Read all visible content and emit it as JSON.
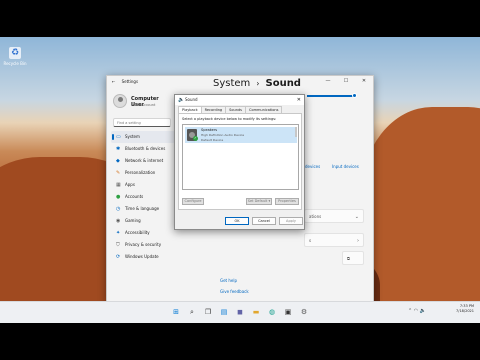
{
  "desktop": {
    "recycle_bin_label": "Recycle Bin"
  },
  "settings": {
    "window_title": "Settings",
    "user": {
      "name": "Computer User",
      "account_type": "Local Account"
    },
    "search_placeholder": "Find a setting",
    "nav": [
      {
        "label": "System",
        "icon": "system-icon",
        "selected": true
      },
      {
        "label": "Bluetooth & devices",
        "icon": "bluetooth-icon"
      },
      {
        "label": "Network & internet",
        "icon": "network-icon"
      },
      {
        "label": "Personalization",
        "icon": "brush-icon"
      },
      {
        "label": "Apps",
        "icon": "apps-icon"
      },
      {
        "label": "Accounts",
        "icon": "account-icon"
      },
      {
        "label": "Time & language",
        "icon": "clock-icon"
      },
      {
        "label": "Gaming",
        "icon": "gamepad-icon"
      },
      {
        "label": "Accessibility",
        "icon": "accessibility-icon"
      },
      {
        "label": "Privacy & security",
        "icon": "shield-icon"
      },
      {
        "label": "Windows Update",
        "icon": "update-icon"
      }
    ],
    "breadcrumb": {
      "parent": "System",
      "current": "Sound"
    },
    "links": {
      "speaker_devices": "devices",
      "input_devices": "Input devices",
      "get_help": "Get help",
      "give_feedback": "Give feedback"
    },
    "cards": [
      "ations",
      "s"
    ]
  },
  "sound_dialog": {
    "title": "Sound",
    "tabs": [
      "Playback",
      "Recording",
      "Sounds",
      "Communications"
    ],
    "instruction": "Select a playback device below to modify its settings:",
    "device": {
      "name": "Speakers",
      "description": "High Definition Audio Device",
      "status": "Default Device"
    },
    "buttons": {
      "configure": "Configure",
      "set_default": "Set Default ▾",
      "properties": "Properties",
      "ok": "OK",
      "cancel": "Cancel",
      "apply": "Apply"
    }
  },
  "taskbar": {
    "time": "7:33 PM",
    "date": "7/18/2021"
  },
  "colors": {
    "accent": "#0067c0",
    "selected_row": "#cce4f7"
  }
}
